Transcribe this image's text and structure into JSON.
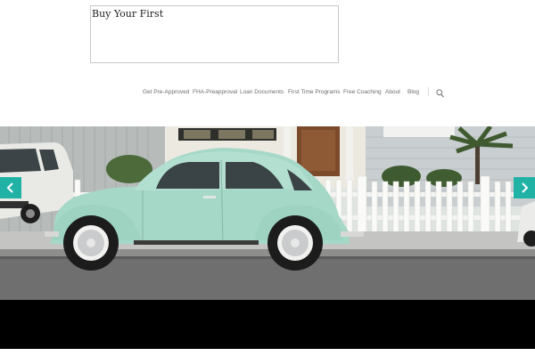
{
  "header": {
    "logo_text": "Buy Your First"
  },
  "nav": {
    "items": [
      {
        "label": "Get Pre-Approved"
      },
      {
        "label": "FHA-Preapproval"
      },
      {
        "label": "Loan Documents"
      },
      {
        "label": "First Time Programs"
      },
      {
        "label": "Free Coaching"
      },
      {
        "label": "About"
      },
      {
        "label": "Blog"
      }
    ],
    "search_icon": "search-icon"
  },
  "slider": {
    "image": "vintage-car-photo",
    "prev_icon": "chevron-left-icon",
    "next_icon": "chevron-right-icon",
    "accent_color": "#21b2a6"
  }
}
